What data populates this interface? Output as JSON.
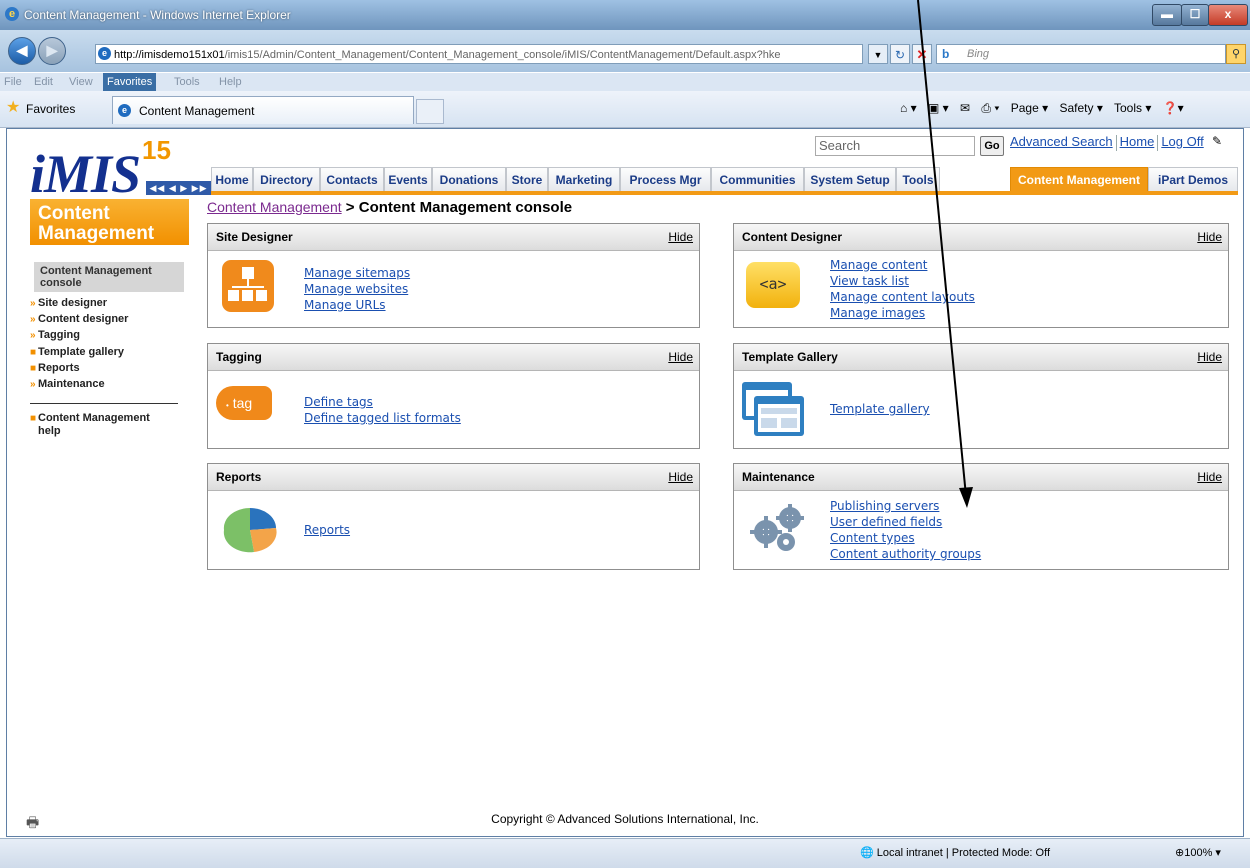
{
  "window": {
    "title": "Content Management - Windows Internet Explorer",
    "min": "▬",
    "max": "☐",
    "close": "x"
  },
  "browser": {
    "url_host": "http://imisdemo151x01",
    "url_path": "/imis15/Admin/Content_Management/Content_Management_console/iMIS/ContentManagement/Default.aspx?hke",
    "search_provider": "Bing",
    "menus": [
      "File",
      "Edit",
      "View",
      "Favorites",
      "Tools",
      "Help"
    ],
    "favorites_label": "Favorites",
    "tab_title": "Content Management",
    "commands": [
      "Page ▾",
      "Safety ▾",
      "Tools ▾"
    ]
  },
  "header": {
    "logo_text": "iMIS",
    "logo_version": "15",
    "search_placeholder": "Search",
    "go_label": "Go",
    "links": [
      "Advanced Search",
      "Home",
      "Log Off"
    ],
    "nav": [
      "Home",
      "Directory",
      "Contacts",
      "Events",
      "Donations",
      "Store",
      "Marketing",
      "Process Mgr",
      "Communities",
      "System Setup",
      "Tools",
      "Content Management",
      "iPart Demos"
    ],
    "active_nav": "Content Management"
  },
  "leftnav": {
    "title_line1": "Content",
    "title_line2": "Management",
    "current_line1": "Content Management",
    "current_line2": "console",
    "items": [
      "Site designer",
      "Content designer",
      "Tagging",
      "Template gallery",
      "Reports",
      "Maintenance"
    ],
    "help_line1": "Content Management",
    "help_line2": "help"
  },
  "breadcrumb": {
    "parent": "Content Management",
    "separator": " > ",
    "current": "Content Management console"
  },
  "panels": {
    "hide_label": "Hide",
    "site_designer": {
      "title": "Site Designer",
      "links": [
        "Manage sitemaps",
        "Manage websites",
        "Manage URLs"
      ]
    },
    "content_designer": {
      "title": "Content Designer",
      "icon_text": "<a>",
      "links": [
        "Manage content",
        "View task list",
        "Manage content layouts",
        "Manage images"
      ]
    },
    "tagging": {
      "title": "Tagging",
      "icon_text": "tag",
      "links": [
        "Define tags",
        "Define tagged list formats"
      ]
    },
    "template_gallery": {
      "title": "Template Gallery",
      "links": [
        "Template gallery"
      ]
    },
    "reports": {
      "title": "Reports",
      "links": [
        "Reports"
      ]
    },
    "maintenance": {
      "title": "Maintenance",
      "links": [
        "Publishing servers",
        "User defined fields",
        "Content types",
        "Content authority groups"
      ]
    }
  },
  "footer": {
    "copyright": "Copyright © Advanced Solutions International, Inc."
  },
  "status": {
    "zone": "Local intranet | Protected Mode: Off",
    "zoom": "100%"
  },
  "colors": {
    "accent": "#f29a15",
    "link": "#1a4fb0",
    "logo": "#13308f"
  }
}
